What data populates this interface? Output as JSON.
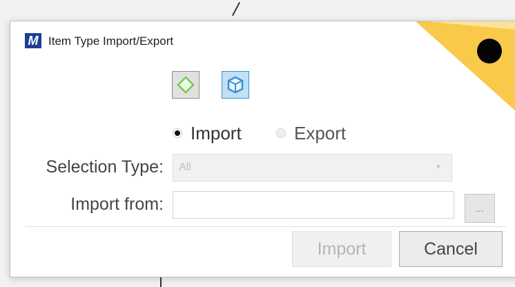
{
  "window": {
    "title": "Item Type Import/Export",
    "app_icon_glyph": "M"
  },
  "mode_icons": [
    {
      "name": "item-type-icon",
      "color": "#78c850"
    },
    {
      "name": "object-cube-icon",
      "color": "#3c8fd0"
    }
  ],
  "mode": {
    "options": [
      {
        "label": "Import",
        "selected": true
      },
      {
        "label": "Export",
        "selected": false
      }
    ]
  },
  "form": {
    "selection_type_label": "Selection Type:",
    "selection_type_value": "All",
    "import_from_label": "Import from:",
    "import_from_value": "",
    "browse_label": "..."
  },
  "actions": {
    "import_label": "Import",
    "cancel_label": "Cancel"
  },
  "colors": {
    "badge_fill": "#f9c94a",
    "selected_button": "#bfe0f7",
    "app_icon": "#1e3f96"
  }
}
